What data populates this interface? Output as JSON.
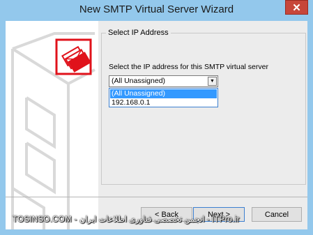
{
  "window": {
    "title": "New SMTP Virtual Server Wizard",
    "close_glyph": "✕"
  },
  "group": {
    "label": "Select IP Address"
  },
  "ip": {
    "prompt": "Select the IP address for this SMTP virtual server",
    "selected": "(All Unassigned)",
    "options": [
      "(All Unassigned)",
      "192.168.0.1"
    ]
  },
  "buttons": {
    "back": "< Back",
    "next": "Next >",
    "cancel": "Cancel"
  },
  "watermark": {
    "text": "TOSINSO.COM - انجمن تخصصی فناوری اطلاعات ایران - ITPro.ir"
  },
  "colors": {
    "title_bar": "#93c8ec",
    "selection": "#3399ff",
    "icon_red": "#e0121b"
  }
}
